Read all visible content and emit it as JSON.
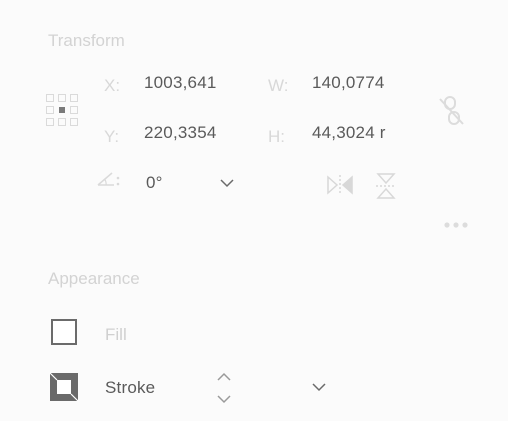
{
  "transform": {
    "title": "Transform",
    "x_label": "X:",
    "x_value": "1003,641",
    "w_label": "W:",
    "w_value": "140,0774",
    "y_label": "Y:",
    "y_value": "220,3354",
    "h_label": "H:",
    "h_value": "44,3024 r",
    "rotate_value": "0°"
  },
  "appearance": {
    "title": "Appearance",
    "fill_label": "Fill",
    "stroke_label": "Stroke"
  },
  "icons": {
    "reference_point": "reference-point-grid-icon",
    "constrain": "unlink-chain-icon",
    "rotate": "angle-icon",
    "flip_h": "flip-horizontal-icon",
    "flip_v": "flip-vertical-icon",
    "more": "more-options-icon",
    "dropdown": "chevron-down-icon",
    "stepper": "stepper-icon"
  },
  "colors": {
    "accent_text": "#5a5a5a",
    "disabled_text": "#d3d3d3"
  }
}
